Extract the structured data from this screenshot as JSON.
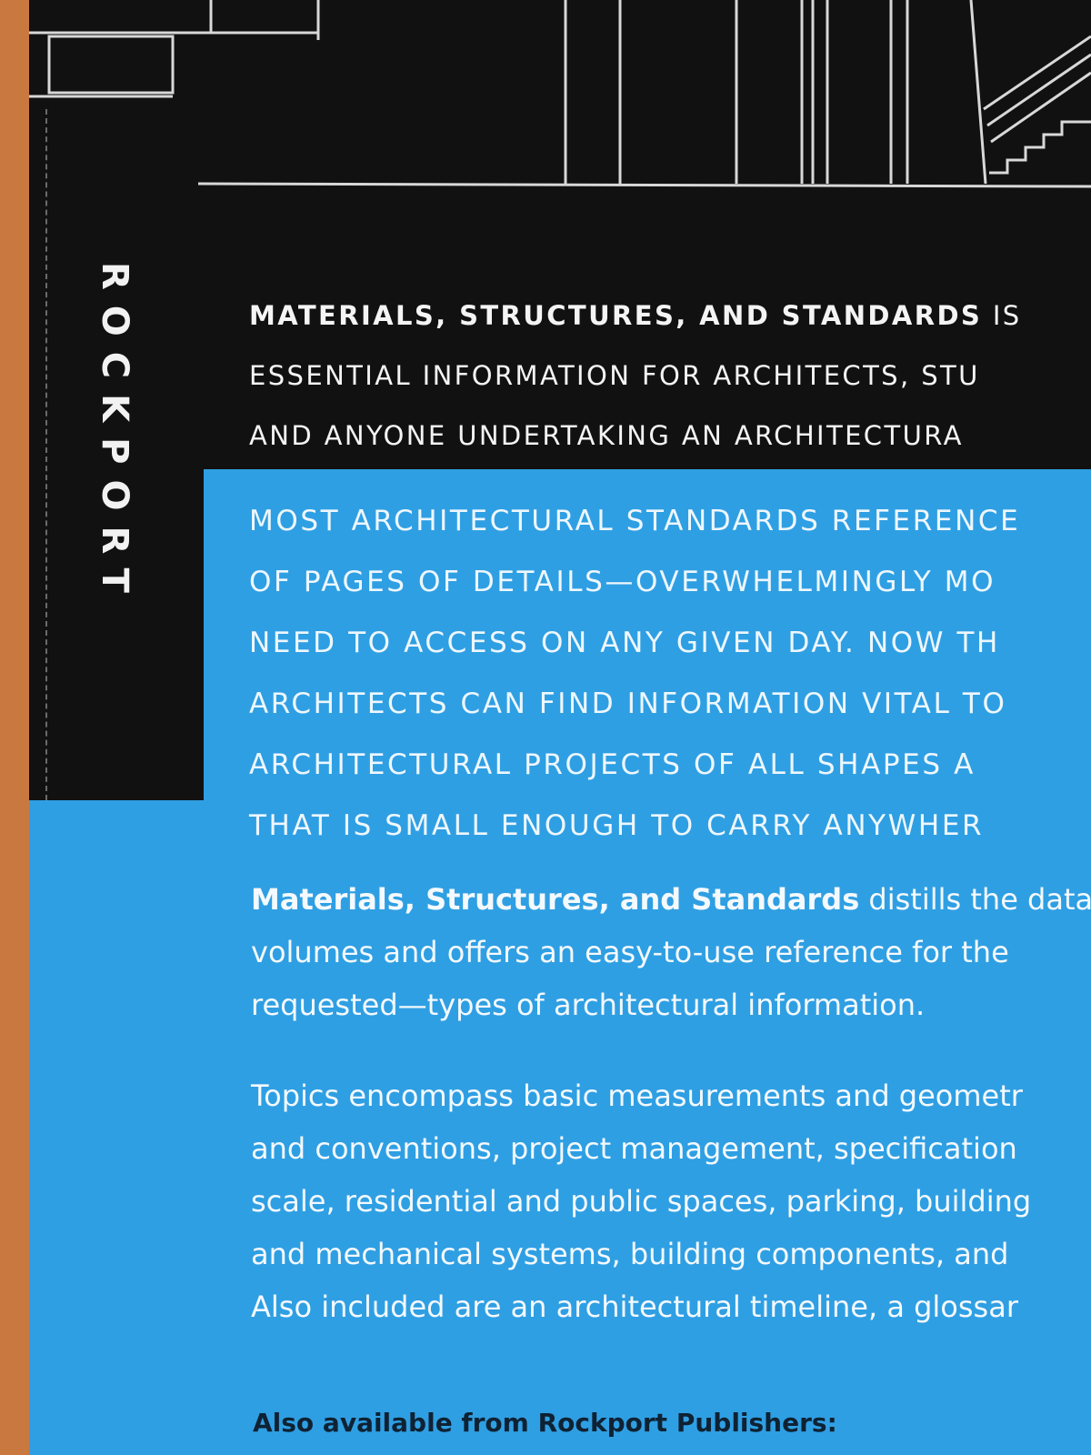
{
  "spine": {
    "publisher": "ROCKPORT"
  },
  "intro": {
    "title_bold": "MATERIALS, STRUCTURES, AND STANDARDS",
    "title_rest": " IS",
    "line2": "ESSENTIAL INFORMATION FOR ARCHITECTS, STU",
    "line3": "AND ANYONE UNDERTAKING AN ARCHITECTURA"
  },
  "blurb_caps": [
    "MOST ARCHITECTURAL STANDARDS REFERENCE",
    "OF PAGES OF DETAILS—OVERWHELMINGLY MO",
    "NEED TO ACCESS ON ANY GIVEN DAY. NOW TH",
    "ARCHITECTS CAN FIND INFORMATION VITAL TO",
    "ARCHITECTURAL PROJECTS OF ALL SHAPES A",
    "THAT IS SMALL ENOUGH TO CARRY ANYWHER"
  ],
  "paragraph1": {
    "bold": "Materials, Structures, and Standards",
    "line1_rest": " distills the data",
    "line2": "volumes and offers an easy-to-use reference for the",
    "line3": "requested—types of architectural information."
  },
  "paragraph2": [
    "Topics encompass basic measurements and geometr",
    "and conventions, project management, specification",
    "scale, residential and public spaces, parking, building",
    "and mechanical systems, building components, and",
    "Also included are an architectural timeline, a glossar"
  ],
  "also_available": "Also available from Rockport Publishers:",
  "colors": {
    "background_surface": "#c9793f",
    "cover_black": "#111111",
    "cover_blue": "#2f9fe3",
    "linework": "#d8d8d8",
    "text_light": "#f4f4f4",
    "text_dark": "#0f2233"
  }
}
